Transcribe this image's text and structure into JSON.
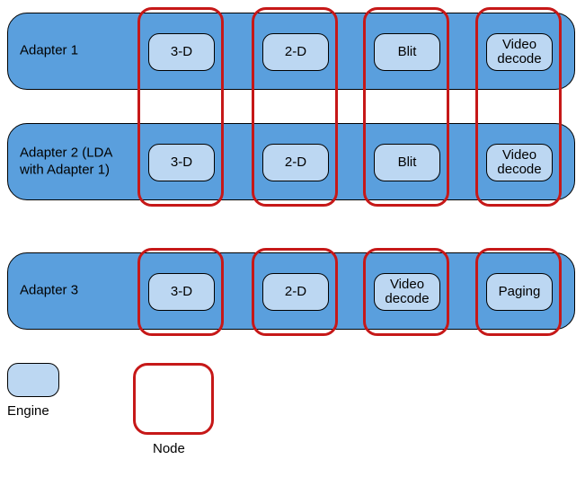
{
  "adapters": [
    {
      "label": "Adapter 1",
      "engines": [
        "3-D",
        "2-D",
        "Blit",
        "Video decode"
      ]
    },
    {
      "label": "Adapter 2 (LDA with Adapter 1)",
      "engines": [
        "3-D",
        "2-D",
        "Blit",
        "Video decode"
      ]
    },
    {
      "label": "Adapter 3",
      "engines": [
        "3-D",
        "2-D",
        "Video decode",
        "Paging"
      ]
    }
  ],
  "legend": {
    "engine": "Engine",
    "node": "Node"
  },
  "colors": {
    "adapter_fill": "#5a9fdd",
    "engine_fill": "#bcd7f2",
    "node_border": "#c61818"
  }
}
